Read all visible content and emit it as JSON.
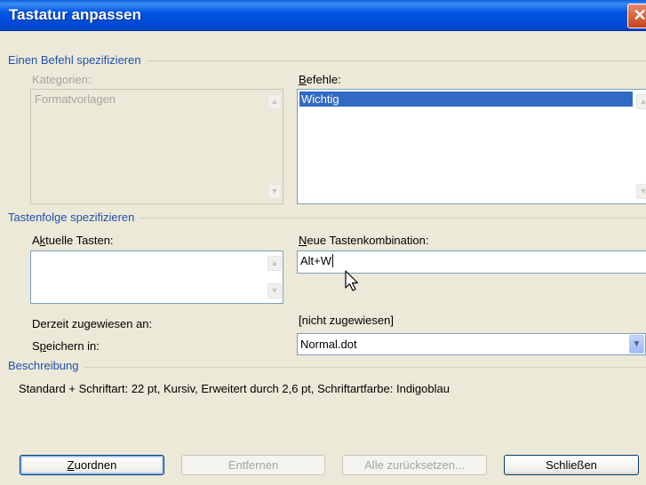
{
  "window": {
    "title": "Tastatur anpassen",
    "close_icon": "close-icon"
  },
  "group_command": {
    "title": "Einen Befehl spezifizieren",
    "categories_label": "Kategorien:",
    "categories_items": [
      "Formatvorlagen"
    ],
    "commands_label_prefix": "",
    "commands_label_u": "B",
    "commands_label_rest": "efehle:",
    "commands_items": [
      "Wichtig"
    ],
    "commands_selected": "Wichtig"
  },
  "group_keys": {
    "title": "Tastenfolge spezifizieren",
    "current_label_prefix": "A",
    "current_label_u": "k",
    "current_label_rest": "tuelle Tasten:",
    "new_label_prefix": "",
    "new_label_u": "N",
    "new_label_rest": "eue Tastenkombination:",
    "new_value": "Alt+W",
    "assigned_label": "Derzeit zugewiesen an:",
    "assigned_value": "[nicht zugewiesen]",
    "save_label_prefix": "S",
    "save_label_u": "p",
    "save_label_rest": "eichern in:",
    "save_value": "Normal.dot"
  },
  "group_desc": {
    "title": "Beschreibung",
    "text": "Standard + Schriftart: 22 pt, Kursiv, Erweitert durch  2,6 pt, Schriftartfarbe: Indigoblau"
  },
  "buttons": {
    "assign_prefix": "",
    "assign_u": "Z",
    "assign_rest": "uordnen",
    "remove": "Entfernen",
    "reset_all": "Alle zurücksetzen...",
    "close": "Schließen"
  },
  "colors": {
    "titlebar": "#0055E5",
    "group_title": "#1F4FB0",
    "selection": "#316AC5",
    "dialog_bg": "#ECE9D8"
  }
}
